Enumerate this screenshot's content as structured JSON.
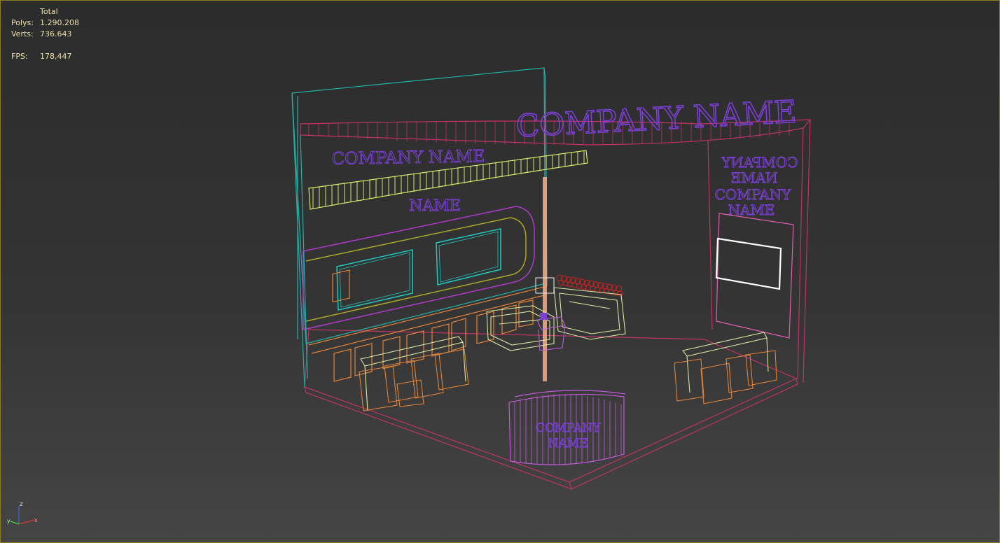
{
  "stats": {
    "header": "Total",
    "polys_label": "Polys:",
    "polys_value": "1.290.208",
    "verts_label": "Verts:",
    "verts_value": "736.643",
    "fps_label": "FPS:",
    "fps_value": "178,447"
  },
  "scene_text": {
    "top_sign": "COMPANY NAME",
    "left_wall_sign": "COMPANY NAME",
    "left_wall_sign_2": "NAME",
    "right_wall_line1": "COMPANY",
    "right_wall_line2": "NAME",
    "right_wall_line3": "COMPANY",
    "right_wall_line4": "NAME",
    "counter_line1": "COMPANY",
    "counter_line2": "NAME"
  },
  "gizmo": {
    "z": "z",
    "x": "x",
    "y": "y"
  },
  "colors": {
    "wall_left": "#1fb3a8",
    "floor": "#c0336a",
    "header_band": "#c0336a",
    "banner": "#d8e86a",
    "text_purple": "#7b3fd6",
    "arch": "#b03acb",
    "monitor": "#1fc9c0",
    "furniture": "#e0833a",
    "counter": "#c25ad8",
    "screen": "#ffffff",
    "pole": "#e8a98a"
  }
}
